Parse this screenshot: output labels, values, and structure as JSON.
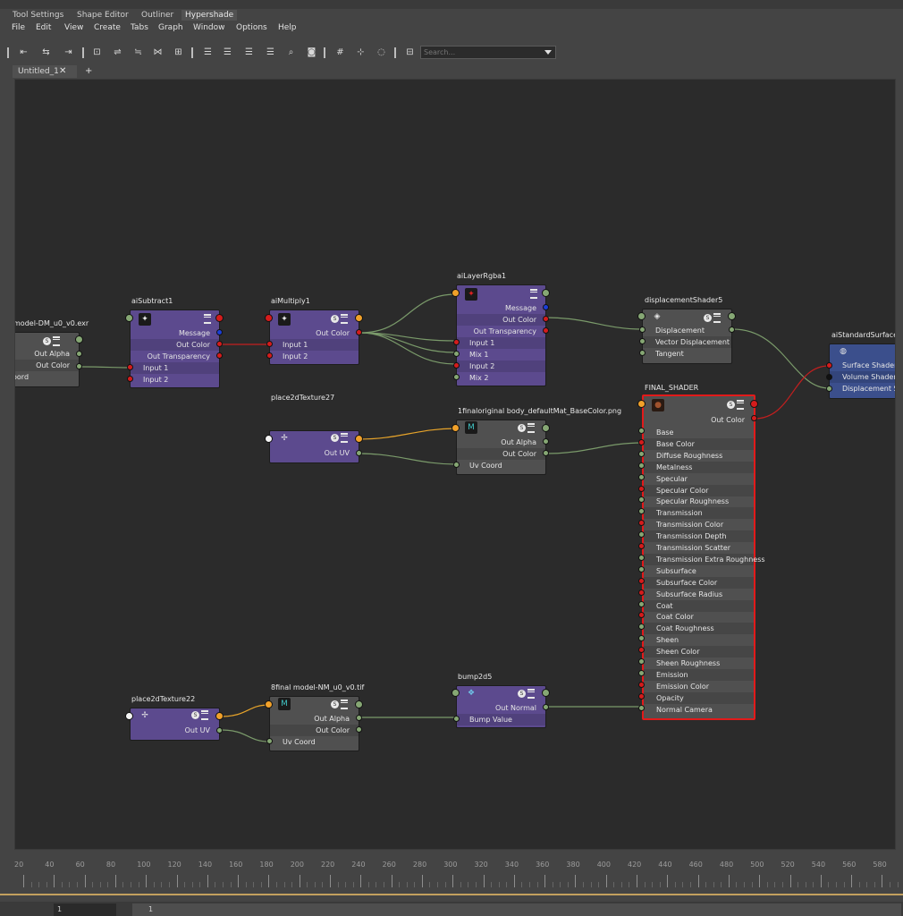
{
  "app": {
    "tabs": [
      "Tool Settings",
      "Shape Editor",
      "Outliner",
      "Hypershade"
    ],
    "active_tab": "Hypershade",
    "menu": [
      "File",
      "Edit",
      "View",
      "Create",
      "Tabs",
      "Graph",
      "Window",
      "Options",
      "Help"
    ],
    "search_placeholder": "Search...",
    "document_tab": "Untitled_1",
    "close_glyph": "✕",
    "add_tab_glyph": "+"
  },
  "nodes": {
    "dm_exr": {
      "title": "model-DM_u0_v0.exr",
      "rows": [
        "Out Alpha",
        "Out Color",
        "oord"
      ]
    },
    "ai_subtract": {
      "title": "aiSubtract1",
      "rows": [
        "Message",
        "Out Color",
        "Out Transparency",
        "Input 1",
        "Input 2"
      ]
    },
    "ai_multiply": {
      "title": "aiMultiply1",
      "rows": [
        "Out Color",
        "Input 1",
        "Input 2"
      ]
    },
    "ai_layer_rgba": {
      "title": "aiLayerRgba1",
      "rows": [
        "Message",
        "Out Color",
        "Out Transparency",
        "Input 1",
        "Mix 1",
        "Input 2",
        "Mix 2"
      ]
    },
    "displacement_shader": {
      "title": "displacementShader5",
      "rows": [
        "Displacement",
        "Vector Displacement",
        "Tangent"
      ]
    },
    "ai_standard_surface": {
      "title": "aiStandardSurface",
      "rows": [
        "Surface Shader",
        "Volume Shader",
        "Displacement Sha"
      ]
    },
    "final_shader": {
      "title": "FINAL_SHADER",
      "out": "Out Color",
      "rows": [
        "Base",
        "Base Color",
        "Diffuse Roughness",
        "Metalness",
        "Specular",
        "Specular Color",
        "Specular Roughness",
        "Transmission",
        "Transmission Color",
        "Transmission Depth",
        "Transmission Scatter",
        "Transmission Extra Roughness",
        "Subsurface",
        "Subsurface Color",
        "Subsurface Radius",
        "Coat",
        "Coat Color",
        "Coat Roughness",
        "Sheen",
        "Sheen Color",
        "Sheen Roughness",
        "Emission",
        "Emission Color",
        "Opacity",
        "Normal Camera"
      ]
    },
    "place2d_27": {
      "title": "place2dTexture27",
      "rows": [
        "Out UV"
      ]
    },
    "basecolor_png": {
      "title": "1finaloriginal body_defaultMat_BaseColor.png",
      "rows": [
        "Out Alpha",
        "Out Color",
        "Uv Coord"
      ]
    },
    "place2d_22": {
      "title": "place2dTexture22",
      "rows": [
        "Out UV"
      ]
    },
    "nm_tif": {
      "title": "8final model-NM_u0_v0.tif",
      "rows": [
        "Out Alpha",
        "Out Color",
        "Uv Coord"
      ]
    },
    "bump2d": {
      "title": "bump2d5",
      "rows": [
        "Out Normal",
        "Bump Value"
      ]
    }
  },
  "timeline": {
    "ticks": [
      "20",
      "40",
      "60",
      "80",
      "100",
      "120",
      "140",
      "160",
      "180",
      "200",
      "220",
      "240",
      "260",
      "280",
      "300",
      "320",
      "340",
      "360",
      "380",
      "400",
      "420",
      "440",
      "460",
      "480",
      "500",
      "520",
      "540",
      "560",
      "580"
    ],
    "current_frame": "1",
    "range_start": "1"
  },
  "colors": {
    "port_color": "#d41c1c",
    "port_float": "#86a774",
    "port_message": "#1b3ed6",
    "port_uv": "#f1a12a",
    "node_texture": "#5c4a8e",
    "node_shader": "#505050",
    "selected_outline": "#e21a1a",
    "wire": "#7a9a6a",
    "wire_uv": "#e6a32a",
    "wire_color": "#c21f1f"
  }
}
